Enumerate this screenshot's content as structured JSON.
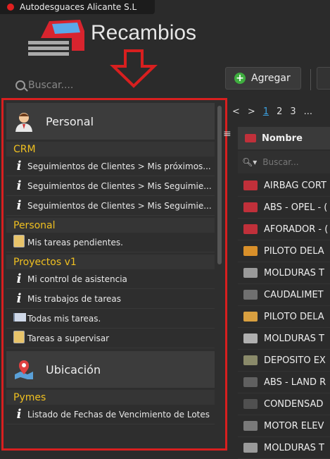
{
  "window": {
    "title": "Autodesguaces Alicante S.L"
  },
  "app": {
    "title": "Recambios"
  },
  "search": {
    "placeholder": "Buscar...."
  },
  "toolbar": {
    "add_label": "Agregar"
  },
  "panel": {
    "groups": [
      {
        "title": "Personal",
        "icon": "person-icon",
        "categories": [
          {
            "name": "CRM",
            "items": [
              {
                "label": "Seguimientos de Clientes > Mis próximos...",
                "icon": "info-icon"
              },
              {
                "label": "Seguimientos de Clientes > Mis Seguimie...",
                "icon": "info-icon"
              },
              {
                "label": "Seguimientos de Clientes > Mis Seguimie...",
                "icon": "info-icon"
              }
            ]
          },
          {
            "name": "Personal",
            "items": [
              {
                "label": "Mis tareas pendientes.",
                "icon": "clipboard-icon"
              }
            ]
          },
          {
            "name": "Proyectos v1",
            "items": [
              {
                "label": "Mi control de asistencia",
                "icon": "info-icon"
              },
              {
                "label": "Mis trabajos de tareas",
                "icon": "info-icon"
              },
              {
                "label": "Todas mis tareas.",
                "icon": "book-icon"
              },
              {
                "label": "Tareas a supervisar",
                "icon": "clipboard-icon"
              }
            ]
          }
        ]
      },
      {
        "title": "Ubicación",
        "icon": "map-pin-icon",
        "categories": [
          {
            "name": "Pymes",
            "items": [
              {
                "label": "Listado de Fechas de Vencimiento de Lotes",
                "icon": "info-icon"
              }
            ]
          }
        ]
      }
    ]
  },
  "pager": {
    "first": "<",
    "next": ">",
    "pages": [
      "1",
      "2",
      "3",
      "..."
    ]
  },
  "grid": {
    "column": "Nombre",
    "filter_placeholder": "Buscar...",
    "rows": [
      {
        "name": "AIRBAG CORT",
        "color": "#c0303a"
      },
      {
        "name": "ABS - OPEL - (",
        "color": "#c0303a"
      },
      {
        "name": "AFORADOR - (",
        "color": "#c0303a"
      },
      {
        "name": "PILOTO DELA",
        "color": "#d9902a"
      },
      {
        "name": "MOLDURAS T",
        "color": "#9a9a9a"
      },
      {
        "name": "CAUDALIMET",
        "color": "#707070"
      },
      {
        "name": "PILOTO DELA",
        "color": "#d9a040"
      },
      {
        "name": "MOLDURAS T",
        "color": "#b0b0b0"
      },
      {
        "name": "DEPOSITO EX",
        "color": "#8a8a6a"
      },
      {
        "name": "ABS - LAND R",
        "color": "#606060"
      },
      {
        "name": "CONDENSAD",
        "color": "#505050"
      },
      {
        "name": "MOTOR ELEV",
        "color": "#7a7a7a"
      },
      {
        "name": "MOLDURAS T",
        "color": "#9a9a9a"
      }
    ]
  }
}
